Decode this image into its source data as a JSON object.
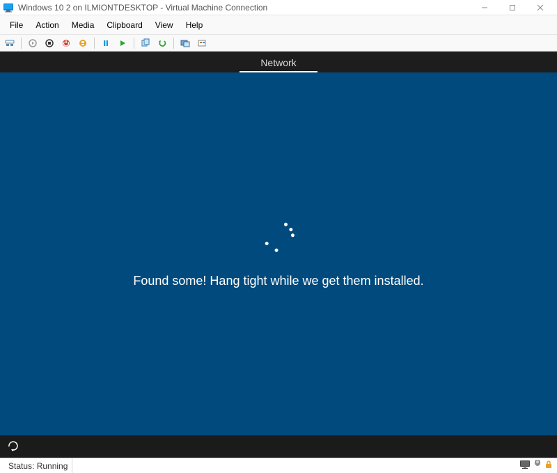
{
  "titlebar": {
    "title": "Windows 10 2 on ILMIONTDESKTOP - Virtual Machine Connection"
  },
  "menubar": {
    "items": [
      "File",
      "Action",
      "Media",
      "Clipboard",
      "View",
      "Help"
    ]
  },
  "toolbar": {
    "icons": [
      "ctrl-alt-del",
      "sep",
      "start-grey",
      "turnoff",
      "shutdown-red",
      "save-orange",
      "sep",
      "pause",
      "reset-green",
      "sep",
      "snapshot",
      "revert-green",
      "sep",
      "enhanced",
      "share"
    ]
  },
  "vm": {
    "tab_label": "Network",
    "setup_message": "Found some! Hang tight while we get them installed.",
    "setup_bg": "#004a7d"
  },
  "statusbar": {
    "status_text": "Status: Running"
  }
}
